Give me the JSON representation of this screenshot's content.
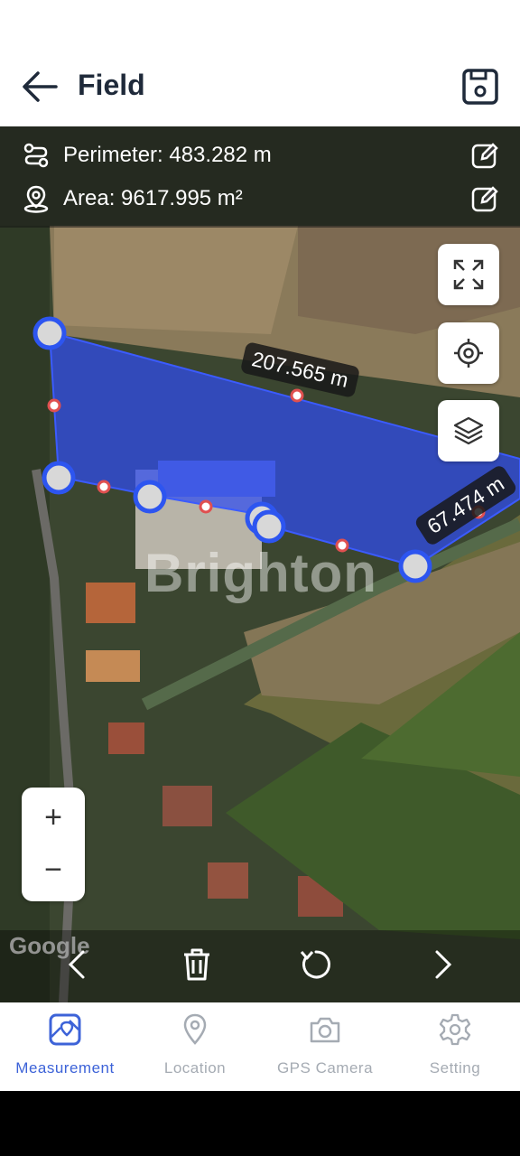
{
  "header": {
    "title": "Field"
  },
  "info": {
    "perimeter": "Perimeter: 483.282 m",
    "area": "Area: 9617.995 m²"
  },
  "map": {
    "segment_top": "207.565 m",
    "segment_right": "67.474 m",
    "watermark": "Brighton",
    "attribution": "Google",
    "zoom_in": "+",
    "zoom_out": "−"
  },
  "nav": {
    "items": [
      {
        "label": "Measurement",
        "active": true
      },
      {
        "label": "Location",
        "active": false
      },
      {
        "label": "GPS Camera",
        "active": false
      },
      {
        "label": "Setting",
        "active": false
      }
    ]
  },
  "colors": {
    "accent": "#3d63d8",
    "polygon_fill": "#2f4cf0",
    "inactive": "#a5abb3"
  }
}
